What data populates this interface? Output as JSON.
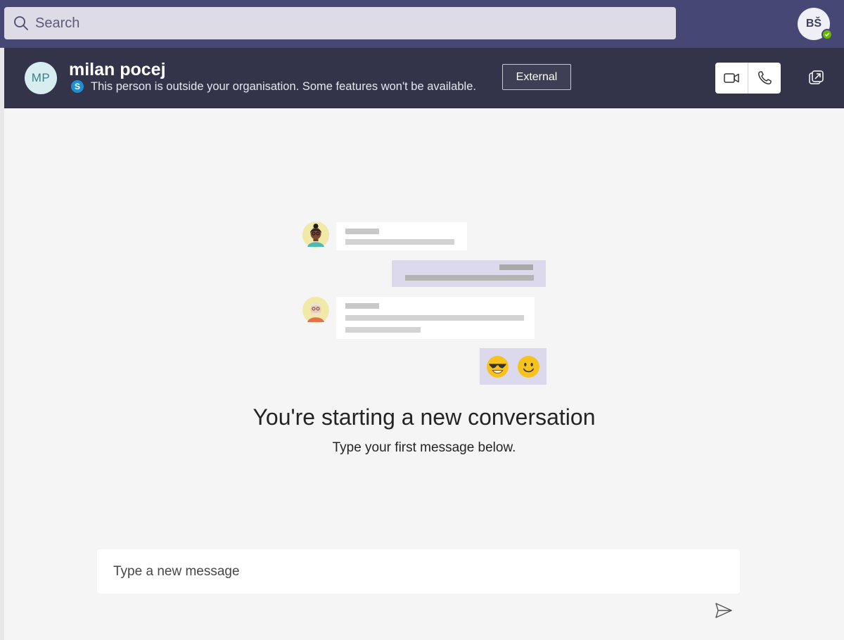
{
  "topbar": {
    "search_placeholder": "Search",
    "user_initials": "BŠ",
    "status_color": "#6bb700"
  },
  "chat_header": {
    "contact_initials": "MP",
    "contact_name": "milan pocej",
    "skype_badge": "S",
    "external_notice": "This person is outside your organisation. Some features won't be available.",
    "external_badge": "External",
    "video_call_icon": "video-camera-icon",
    "audio_call_icon": "phone-icon",
    "popout_icon": "popout-icon"
  },
  "empty_state": {
    "title": "You're starting a new conversation",
    "subtitle": "Type your first message below."
  },
  "composer": {
    "placeholder": "Type a new message",
    "send_icon": "send-icon"
  },
  "colors": {
    "topbar": "#464775",
    "header": "#33344a",
    "background": "#f5f5f5",
    "accent_bubble": "#dcd9ec"
  }
}
